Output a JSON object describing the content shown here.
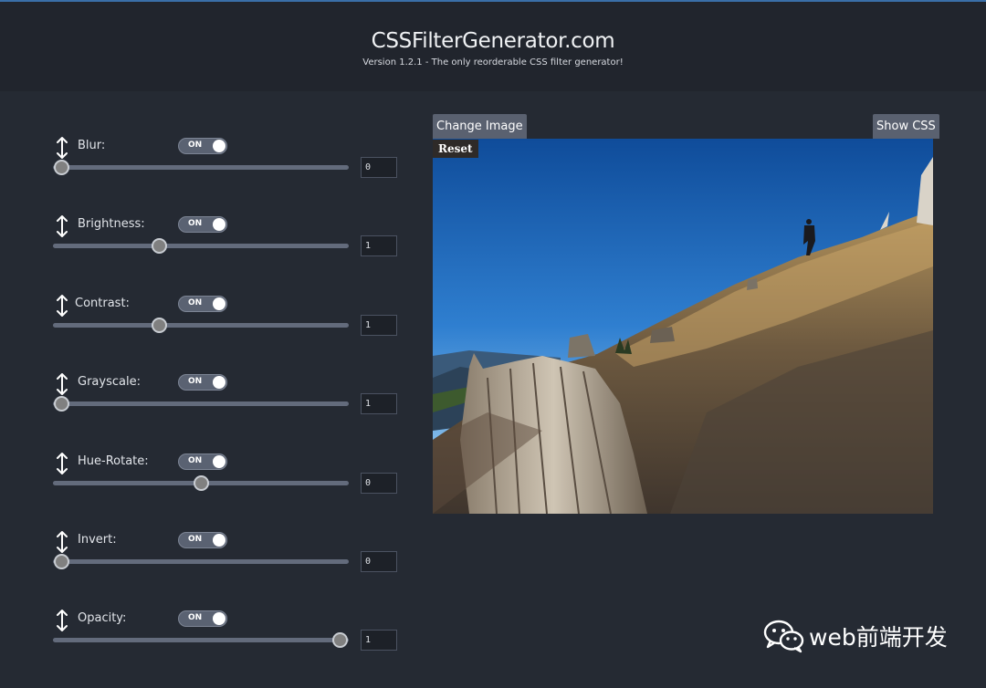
{
  "header": {
    "title": "CSSFilterGenerator.com",
    "subtitle": "Version 1.2.1 - The only reorderable CSS filter generator!"
  },
  "filters": [
    {
      "label": "Blur:",
      "toggle": "ON",
      "value": "0",
      "slider_fraction": 0.0
    },
    {
      "label": "Brightness:",
      "toggle": "ON",
      "value": "1",
      "slider_fraction": 0.35
    },
    {
      "label": "Contrast:",
      "toggle": "ON",
      "value": "1",
      "slider_fraction": 0.35
    },
    {
      "label": "Grayscale:",
      "toggle": "ON",
      "value": "1",
      "slider_fraction": 0.0
    },
    {
      "label": "Hue-Rotate:",
      "toggle": "ON",
      "value": "0",
      "slider_fraction": 0.5
    },
    {
      "label": "Invert:",
      "toggle": "ON",
      "value": "0",
      "slider_fraction": 0.0
    },
    {
      "label": "Opacity:",
      "toggle": "ON",
      "value": "1",
      "slider_fraction": 1.0
    }
  ],
  "preview": {
    "change_image_label": "Change Image",
    "show_css_label": "Show CSS",
    "reset_label": "Reset"
  },
  "watermark": {
    "text": "web前端开发",
    "icon": "wechat-icon"
  },
  "colors": {
    "page_background": "#252a33",
    "header_background": "#21252d",
    "button_background": "#5a6170",
    "toggle_background": "#5a6272"
  }
}
